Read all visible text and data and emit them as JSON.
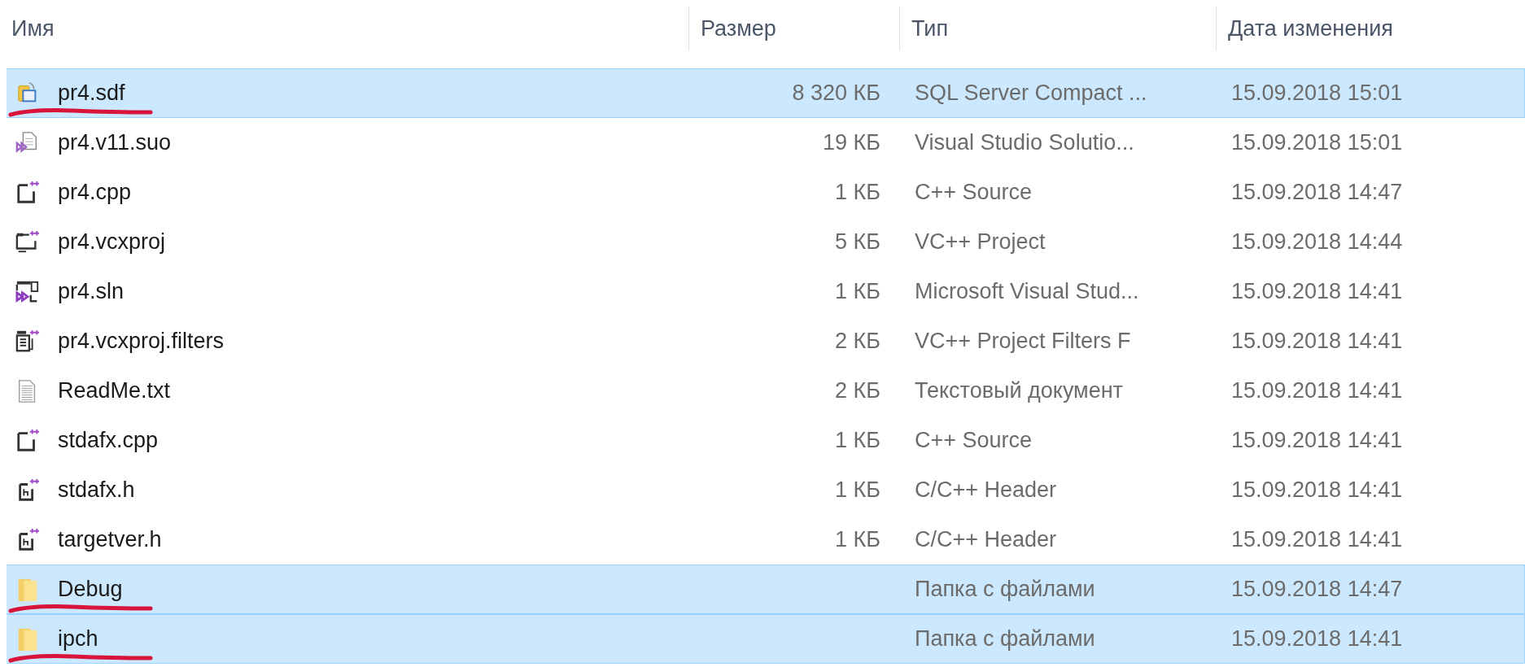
{
  "columns": [
    "Имя",
    "Размер",
    "Тип",
    "Дата изменения"
  ],
  "rows": [
    {
      "kind": "database",
      "name": "pr4.sdf",
      "size": "8 320 КБ",
      "type": "SQL Server Compact ...",
      "date": "15.09.2018 15:01",
      "selected": true,
      "underlined": true
    },
    {
      "kind": "options",
      "name": "pr4.v11.suo",
      "size": "19 КБ",
      "type": "Visual Studio Solutio...",
      "date": "15.09.2018 15:01",
      "selected": false,
      "underlined": false
    },
    {
      "kind": "cpp",
      "name": "pr4.cpp",
      "size": "1 КБ",
      "type": "C++ Source",
      "date": "15.09.2018 14:47",
      "selected": false,
      "underlined": false
    },
    {
      "kind": "project",
      "name": "pr4.vcxproj",
      "size": "5 КБ",
      "type": "VC++ Project",
      "date": "15.09.2018 14:44",
      "selected": false,
      "underlined": false
    },
    {
      "kind": "solution",
      "name": "pr4.sln",
      "size": "1 КБ",
      "type": "Microsoft Visual Stud...",
      "date": "15.09.2018 14:41",
      "selected": false,
      "underlined": false
    },
    {
      "kind": "filters",
      "name": "pr4.vcxproj.filters",
      "size": "2 КБ",
      "type": "VC++ Project Filters F",
      "date": "15.09.2018 14:41",
      "selected": false,
      "underlined": false
    },
    {
      "kind": "text",
      "name": "ReadMe.txt",
      "size": "2 КБ",
      "type": "Текстовый документ",
      "date": "15.09.2018 14:41",
      "selected": false,
      "underlined": false
    },
    {
      "kind": "cpp",
      "name": "stdafx.cpp",
      "size": "1 КБ",
      "type": "C++ Source",
      "date": "15.09.2018 14:41",
      "selected": false,
      "underlined": false
    },
    {
      "kind": "header",
      "name": "stdafx.h",
      "size": "1 КБ",
      "type": "C/C++ Header",
      "date": "15.09.2018 14:41",
      "selected": false,
      "underlined": false
    },
    {
      "kind": "header",
      "name": "targetver.h",
      "size": "1 КБ",
      "type": "C/C++ Header",
      "date": "15.09.2018 14:41",
      "selected": false,
      "underlined": false
    },
    {
      "kind": "folder",
      "name": "Debug",
      "type": "Папка с файлами",
      "date": "15.09.2018 14:47",
      "selected": true,
      "underlined": true
    },
    {
      "kind": "folder",
      "name": "ipch",
      "type": "Папка с файлами",
      "date": "15.09.2018 14:41",
      "selected": true,
      "underlined": true
    }
  ]
}
